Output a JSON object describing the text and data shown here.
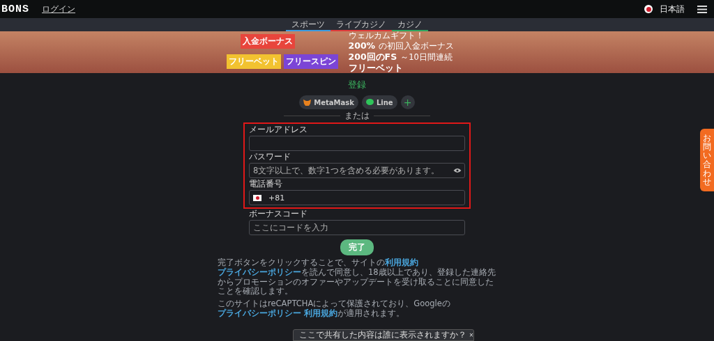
{
  "header": {
    "logo": "BONS",
    "login_link": "ログイン",
    "language": "日本語"
  },
  "category_tabs": [
    {
      "label": "スポーツ",
      "color": "#3b9be0"
    },
    {
      "label": "ライブカジノ",
      "color": "#e03b3b"
    },
    {
      "label": "カジノ",
      "color": "#2ea860"
    }
  ],
  "banner": {
    "badges": [
      {
        "label": "入金ボーナス",
        "color": "#e8453c"
      },
      {
        "label": "フリーベット",
        "color": "#f2c230"
      },
      {
        "label": "フリースピン",
        "color": "#7b45d6"
      }
    ],
    "subtitle": "ウェルカムギフト！",
    "lines": [
      {
        "big": "200%",
        "small": "の初回入金ボーナス"
      },
      {
        "big": "200回のFS",
        "small": "～10日間連続"
      },
      {
        "big": "フリーベット"
      }
    ]
  },
  "form": {
    "title": "登録",
    "social": [
      {
        "kind": "metamask",
        "label": "MetaMask"
      },
      {
        "kind": "line",
        "label": "Line"
      },
      {
        "kind": "more",
        "label": "+"
      }
    ],
    "divider": "または",
    "fields": [
      {
        "kind": "email",
        "label": "メールアドレス"
      },
      {
        "kind": "password",
        "label": "パスワード",
        "placeholder": "8文字以上で、数字1つを含める必要があります。"
      },
      {
        "kind": "phone",
        "label": "電話番号",
        "value": "+81"
      },
      {
        "kind": "text",
        "label": "ボーナスコード",
        "placeholder": "ここにコードを入力"
      }
    ],
    "submit": "完了",
    "terms": [
      {
        "text": "完了ボタンをクリックすることで、サイトの",
        "links": [
          "利用規約",
          "プライバシーポリシー"
        ],
        "rest": "を読んで同意し、18歳以上であり、登録した連絡先からプロモーションのオファーやアップデートを受け取ることに同意したことを確認します。"
      },
      {
        "text": "このサイトはreCAPTCHAによって保護されており、Googleの",
        "links": [
          "プライバシーポリシー",
          "利用規約"
        ],
        "rest": "が適用されます。"
      }
    ]
  },
  "contact_tab": "お問い合わせ",
  "popup": {
    "text": "ここで共有した内容は誰に表示されますか？",
    "close": "×"
  }
}
